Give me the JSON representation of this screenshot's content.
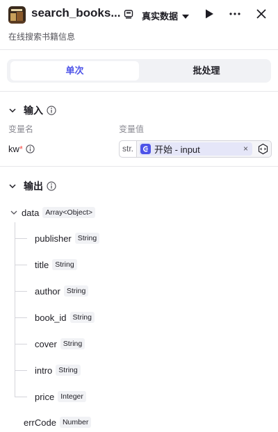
{
  "header": {
    "title": "search_books...",
    "subtitle": "在线搜索书籍信息",
    "data_select": "真实数据",
    "icons": [
      "book-app-icon",
      "camera-icon",
      "caret-down-icon",
      "play-icon",
      "more-icon",
      "close-icon"
    ]
  },
  "tabs": [
    {
      "label": "单次",
      "active": true
    },
    {
      "label": "批处理",
      "active": false
    }
  ],
  "input_section": {
    "title": "输入",
    "col_name": "变量名",
    "col_value": "变量值",
    "variable": {
      "name": "kw",
      "required_mark": "*",
      "type_tag": "str.",
      "ref_source": "开始",
      "ref_separator": " - ",
      "ref_field": "input",
      "clear": "×"
    }
  },
  "output_section": {
    "title": "输出",
    "root": {
      "name": "data",
      "type": "Array<Object>"
    },
    "children": [
      {
        "name": "publisher",
        "type": "String"
      },
      {
        "name": "title",
        "type": "String"
      },
      {
        "name": "author",
        "type": "String"
      },
      {
        "name": "book_id",
        "type": "String"
      },
      {
        "name": "cover",
        "type": "String"
      },
      {
        "name": "intro",
        "type": "String"
      },
      {
        "name": "price",
        "type": "Integer"
      }
    ],
    "extra": {
      "name": "errCode",
      "type": "Number"
    }
  },
  "colors": {
    "accent": "#4d53e8",
    "required": "#f54a45",
    "pill_bg": "#e5e6f8"
  }
}
